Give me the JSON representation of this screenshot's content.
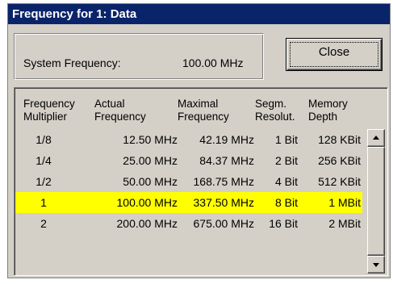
{
  "window": {
    "title": "Frequency for 1: Data"
  },
  "system": {
    "label": "System Frequency:",
    "value": "100.00 MHz"
  },
  "close_label": "Close",
  "table": {
    "headers": [
      [
        "Frequency",
        "Multiplier"
      ],
      [
        "Actual",
        "Frequency"
      ],
      [
        "Maximal",
        "Frequency"
      ],
      [
        "Segm.",
        "Resolut."
      ],
      [
        "Memory",
        "Depth"
      ]
    ],
    "rows": [
      [
        "1/8",
        "12.50 MHz",
        "42.19 MHz",
        "1 Bit",
        "128 KBit"
      ],
      [
        "1/4",
        "25.00 MHz",
        "84.37 MHz",
        "2 Bit",
        "256 KBit"
      ],
      [
        "1/2",
        "50.00 MHz",
        "168.75 MHz",
        "4 Bit",
        "512 KBit"
      ],
      [
        "1",
        "100.00 MHz",
        "337.50 MHz",
        "8 Bit",
        "1 MBit"
      ],
      [
        "2",
        "200.00 MHz",
        "675.00 MHz",
        "16 Bit",
        "2 MBit"
      ]
    ],
    "selected_row": 3
  },
  "colors": {
    "title_bg": "#0a246a",
    "highlight": "#ffff00",
    "face": "#d4d0c8"
  },
  "icons": {
    "scroll_up": "arrow-up-icon",
    "scroll_down": "arrow-down-icon"
  }
}
